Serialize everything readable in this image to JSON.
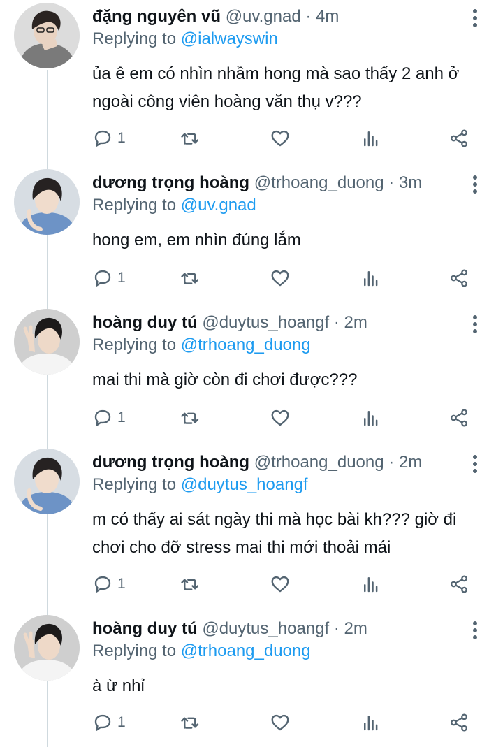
{
  "colors": {
    "text": "#0f1419",
    "secondary": "#536471",
    "accent": "#1d9bf0",
    "thread_line": "#cfd9de"
  },
  "tweets": [
    {
      "name": "đặng nguyên vũ",
      "handle": "@uv.gnad",
      "separator": "·",
      "time": "4m",
      "replying_label": "Replying to",
      "replying_to": "@ialwayswin",
      "text": "ủa ê em có nhìn nhầm hong mà sao thấy 2 anh ở ngoài công viên hoàng văn thụ v???",
      "reply_count": "1"
    },
    {
      "name": "dương trọng hoàng",
      "handle": "@trhoang_duong",
      "separator": "·",
      "time": "3m",
      "replying_label": "Replying to",
      "replying_to": "@uv.gnad",
      "text": "hong em, em nhìn đúng lắm",
      "reply_count": "1"
    },
    {
      "name": "hoàng duy tú",
      "handle": "@duytus_hoangf",
      "separator": "·",
      "time": "2m",
      "replying_label": "Replying to",
      "replying_to": "@trhoang_duong",
      "text": "mai thi mà giờ còn đi chơi được???",
      "reply_count": "1"
    },
    {
      "name": "dương trọng hoàng",
      "handle": "@trhoang_duong",
      "separator": "·",
      "time": "2m",
      "replying_label": "Replying to",
      "replying_to": "@duytus_hoangf",
      "text": "m có thấy ai sát ngày thi mà học bài kh??? giờ đi chơi cho đỡ stress mai thi mới thoải mái",
      "reply_count": "1"
    },
    {
      "name": "hoàng duy tú",
      "handle": "@duytus_hoangf",
      "separator": "·",
      "time": "2m",
      "replying_label": "Replying to",
      "replying_to": "@trhoang_duong",
      "text": "à ừ nhỉ",
      "reply_count": "1"
    }
  ],
  "icons": {
    "reply": "reply-icon",
    "retweet": "retweet-icon",
    "like": "heart-icon",
    "views": "views-icon",
    "share": "share-icon",
    "more": "more-options-icon",
    "avatar": "avatar"
  }
}
